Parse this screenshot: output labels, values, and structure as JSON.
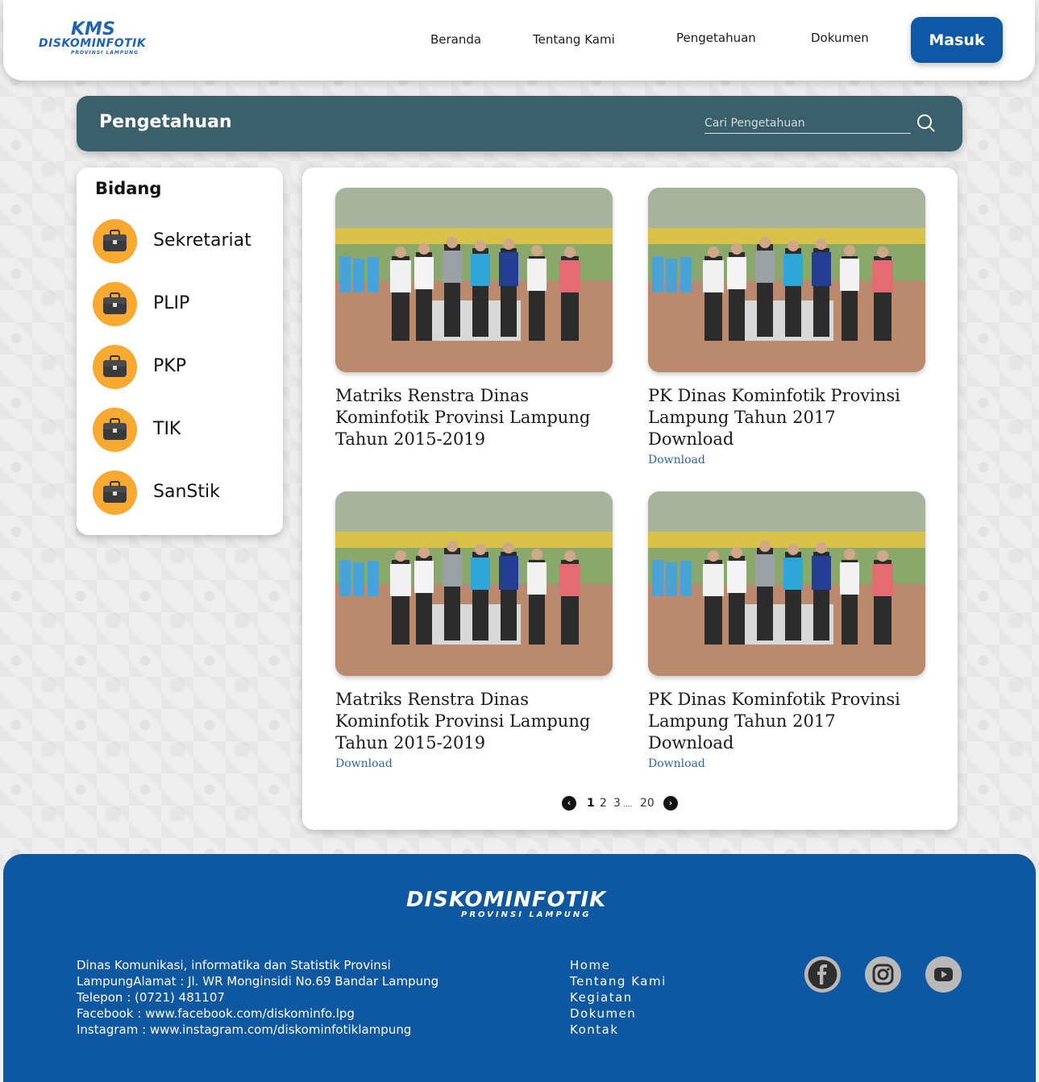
{
  "brand": {
    "top": "KMS",
    "name": "DISKOMINFOTIK",
    "sub": "PROVINSI LAMPUNG"
  },
  "nav": {
    "items": [
      "Beranda",
      "Tentang Kami",
      "Pengetahuan",
      "Dokumen"
    ],
    "login": "Masuk"
  },
  "page": {
    "title": "Pengetahuan",
    "search_placeholder": "Cari Pengetahuan"
  },
  "sidebar": {
    "heading": "Bidang",
    "items": [
      "Sekretariat",
      "PLIP",
      "PKP",
      "TIK",
      "SanStik"
    ],
    "icon": "briefcase-icon",
    "icon_bg": "#f7a932"
  },
  "cards": [
    {
      "title": "Matriks Renstra Dinas Kominfotik  Provinsi Lampung Tahun 2015-2019",
      "download": ""
    },
    {
      "title": "PK Dinas Kominfotik Provinsi Lampung Tahun 2017 Download",
      "download": "Download"
    },
    {
      "title": "Matriks Renstra Dinas Kominfotik  Provinsi Lampung Tahun 2015-2019",
      "download": "Download"
    },
    {
      "title": "PK Dinas Kominfotik Provinsi Lampung Tahun 2017 Download",
      "download": "Download"
    }
  ],
  "pagination": {
    "pages": [
      "1",
      "2",
      "3",
      "20"
    ],
    "ellipsis": "....",
    "current": "1"
  },
  "footer": {
    "brand": "DISKOMINFOTIK",
    "brand_sub": "PROVINSI LAMPUNG",
    "info": [
      "Dinas Komunikasi, informatika dan Statistik Provinsi",
      "LampungAlamat : Jl. WR Monginsidi No.69 Bandar Lampung",
      "Telepon : (0721) 481107",
      "Facebook : www.facebook.com/diskominfo.lpg",
      "Instagram : www.instagram.com/diskominfotiklampung"
    ],
    "links": [
      "Home",
      "Tentang Kami",
      "Kegiatan",
      "Dokumen",
      "Kontak"
    ],
    "social": [
      "facebook-icon",
      "instagram-icon",
      "youtube-icon"
    ]
  },
  "colors": {
    "primary": "#0e58a6",
    "titlebar": "#3b5f6b",
    "accent": "#f7a932",
    "footer": "#0e57a1"
  }
}
